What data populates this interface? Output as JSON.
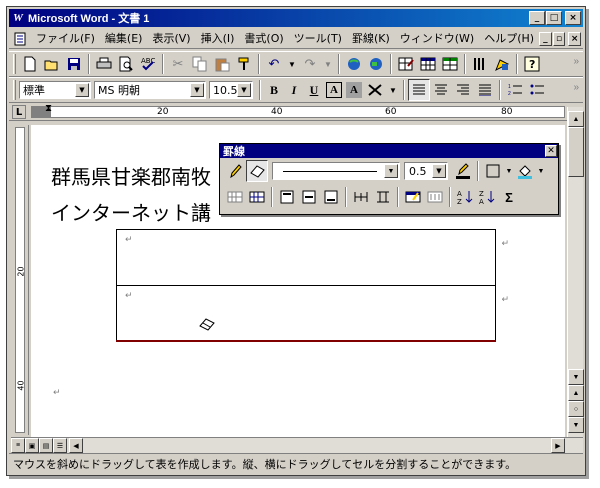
{
  "window": {
    "title": "Microsoft Word - 文書 1",
    "app_icon": "W"
  },
  "titlebar_buttons": {
    "minimize": "_",
    "maximize": "□",
    "close": "×"
  },
  "doc_buttons": {
    "minimize": "_",
    "restore": "▫",
    "close": "×"
  },
  "menu": {
    "items": [
      {
        "label": "ファイル(F)"
      },
      {
        "label": "編集(E)"
      },
      {
        "label": "表示(V)"
      },
      {
        "label": "挿入(I)"
      },
      {
        "label": "書式(O)"
      },
      {
        "label": "ツール(T)"
      },
      {
        "label": "罫線(K)"
      },
      {
        "label": "ウィンドウ(W)"
      },
      {
        "label": "ヘルプ(H)"
      }
    ]
  },
  "standard_toolbar": {
    "icons": [
      "new-icon",
      "open-icon",
      "save-icon",
      "print-icon",
      "print-preview-icon",
      "spelling-icon",
      "cut-icon",
      "copy-icon",
      "paste-icon",
      "format-painter-icon",
      "undo-icon",
      "redo-icon",
      "hyperlink-icon",
      "web-toolbar-icon",
      "tables-borders-icon",
      "insert-table-icon",
      "insert-excel-icon",
      "columns-icon",
      "drawing-icon",
      "help-icon"
    ]
  },
  "formatting_toolbar": {
    "style": "標準",
    "font": "MS 明朝",
    "size": "10.5",
    "bold": "B",
    "italic": "I",
    "underline": "U",
    "char_border": "A",
    "char_shading": "A"
  },
  "ruler": {
    "tab_selector": "L",
    "labels": [
      "20",
      "40",
      "60",
      "80"
    ]
  },
  "vruler": {
    "labels": [
      "20",
      "40"
    ]
  },
  "document": {
    "line1": "群馬県甘楽郡南牧",
    "line2": "インターネット講",
    "para_mark": "↵",
    "cell_mark": "↵"
  },
  "palette": {
    "title": "罫線",
    "line_weight": "0.5",
    "sum_label": "Σ"
  },
  "status": {
    "text": "マウスを斜めにドラッグして表を作成します。縦、横にドラッグしてセルを分割することができます。"
  }
}
